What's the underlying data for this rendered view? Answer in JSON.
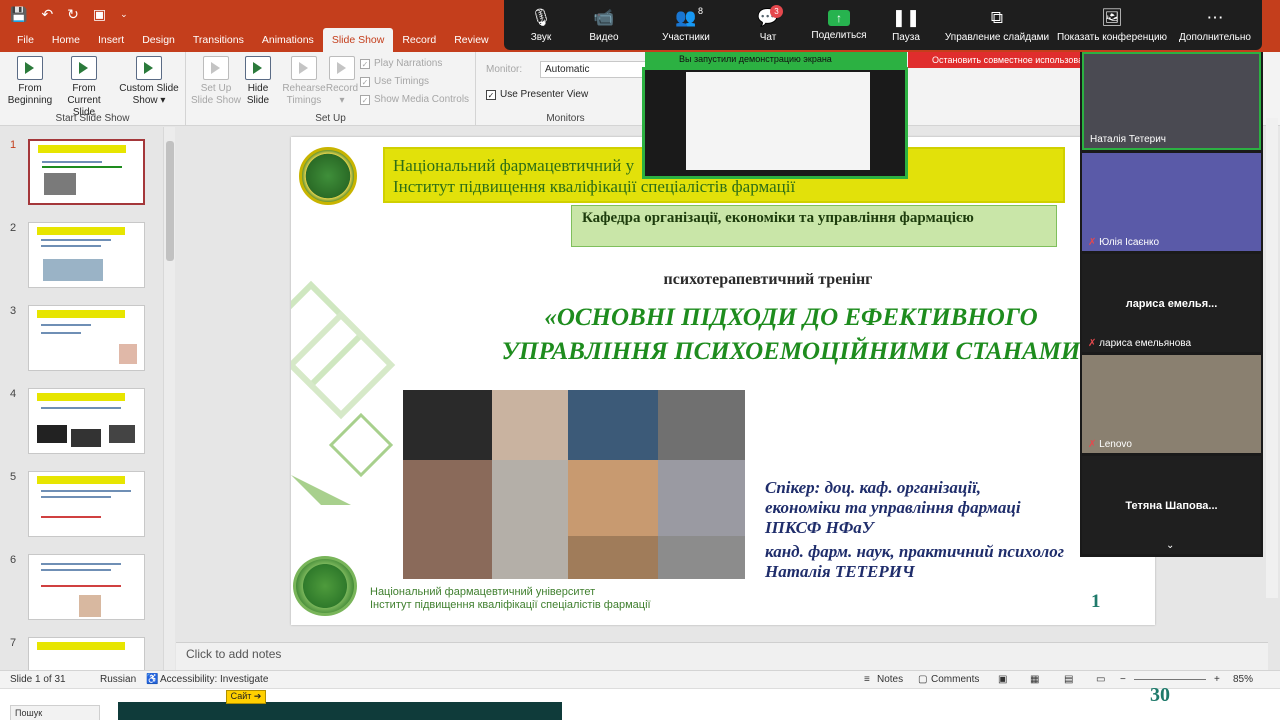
{
  "ribbon": {
    "tabs": [
      "File",
      "Home",
      "Insert",
      "Design",
      "Transitions",
      "Animations",
      "Slide Show",
      "Record",
      "Review"
    ],
    "active_tab": "Slide Show",
    "buttons": {
      "from_beginning": [
        "From",
        "Beginning"
      ],
      "from_current": [
        "From",
        "Current Slide"
      ],
      "custom_show": [
        "Custom Slide",
        "Show ▾"
      ],
      "set_up_show": [
        "Set Up",
        "Slide Show"
      ],
      "hide_slide": [
        "Hide",
        "Slide"
      ],
      "rehearse": [
        "Rehearse",
        "Timings"
      ],
      "record": [
        "Record",
        "▾"
      ]
    },
    "checkboxes": {
      "play_narrations": "Play Narrations",
      "use_timings": "Use Timings",
      "show_media_controls": "Show Media Controls",
      "use_presenter_view": "Use Presenter View"
    },
    "monitor_label": "Monitor:",
    "monitor_value": "Automatic",
    "groups": {
      "start": "Start Slide Show",
      "setup": "Set Up",
      "monitors": "Monitors"
    }
  },
  "thumbnails": [
    "1",
    "2",
    "3",
    "4",
    "5",
    "6",
    "7"
  ],
  "slide": {
    "banner_line1": "Національний фармацевтичний у",
    "banner_line2": "Інститут підвищення кваліфікації спеціалістів фармації",
    "department": "Кафедра організації, економіки та управління фармацією",
    "subtitle": "психотерапевтичний тренінг",
    "title_line1": "«ОСНОВНІ ПІДХОДИ ДО ЕФЕКТИВНОГО",
    "title_line2": "УПРАВЛІННЯ ПСИХОЕМОЦІЙНИМИ СТАНАМИ",
    "speaker_line1": "Спікер: доц. каф. організації,",
    "speaker_line2": "економіки та управління фармаці",
    "speaker_line3": "ІПКСФ НФаУ",
    "speaker_line4": "канд. фарм. наук, практичний психолог",
    "speaker_line5": "Наталія ТЕТЕРИЧ",
    "footer_line1": "Національний фармацевтичний університет",
    "footer_line2": "Інститут підвищення кваліфікації спеціалістів фармації",
    "page_number": "1"
  },
  "notes_placeholder": "Click to add notes",
  "status": {
    "slide_counter": "Slide 1 of 31",
    "language": "Russian",
    "accessibility": "Accessibility: Investigate",
    "notes": "Notes",
    "comments": "Comments",
    "zoom": "85%"
  },
  "zoom_toolbar": {
    "audio": "Звук",
    "video": "Видео",
    "participants": "Участники",
    "participants_count": "8",
    "chat": "Чат",
    "chat_badge": "3",
    "share": "Поделиться",
    "pause": "Пауза",
    "manage_slides": "Управление слайдами",
    "show_conference": "Показать конференцию",
    "more": "Дополнительно"
  },
  "sharing_notice": "Вы запустили демонстрацию экрана",
  "stop_sharing": "Остановить совместное использование",
  "participants": [
    {
      "name": "Наталія Тетерич"
    },
    {
      "name": "Юлія Ісаєнко"
    },
    {
      "name": "лариса емельянова",
      "center": "лариса  емелья..."
    },
    {
      "name": "Lenovo"
    },
    {
      "center": "Тетяна  Шапова..."
    }
  ],
  "taskbar": {
    "search": "Пошук",
    "site_button": "Сайт ➔"
  },
  "ghost_number": "30",
  "colors": {
    "brand": "#c43e1c",
    "slide_title": "#1e8c1e",
    "banner": "#e2e10a",
    "share_green": "#2cb142",
    "stop_red": "#e02d2d"
  }
}
